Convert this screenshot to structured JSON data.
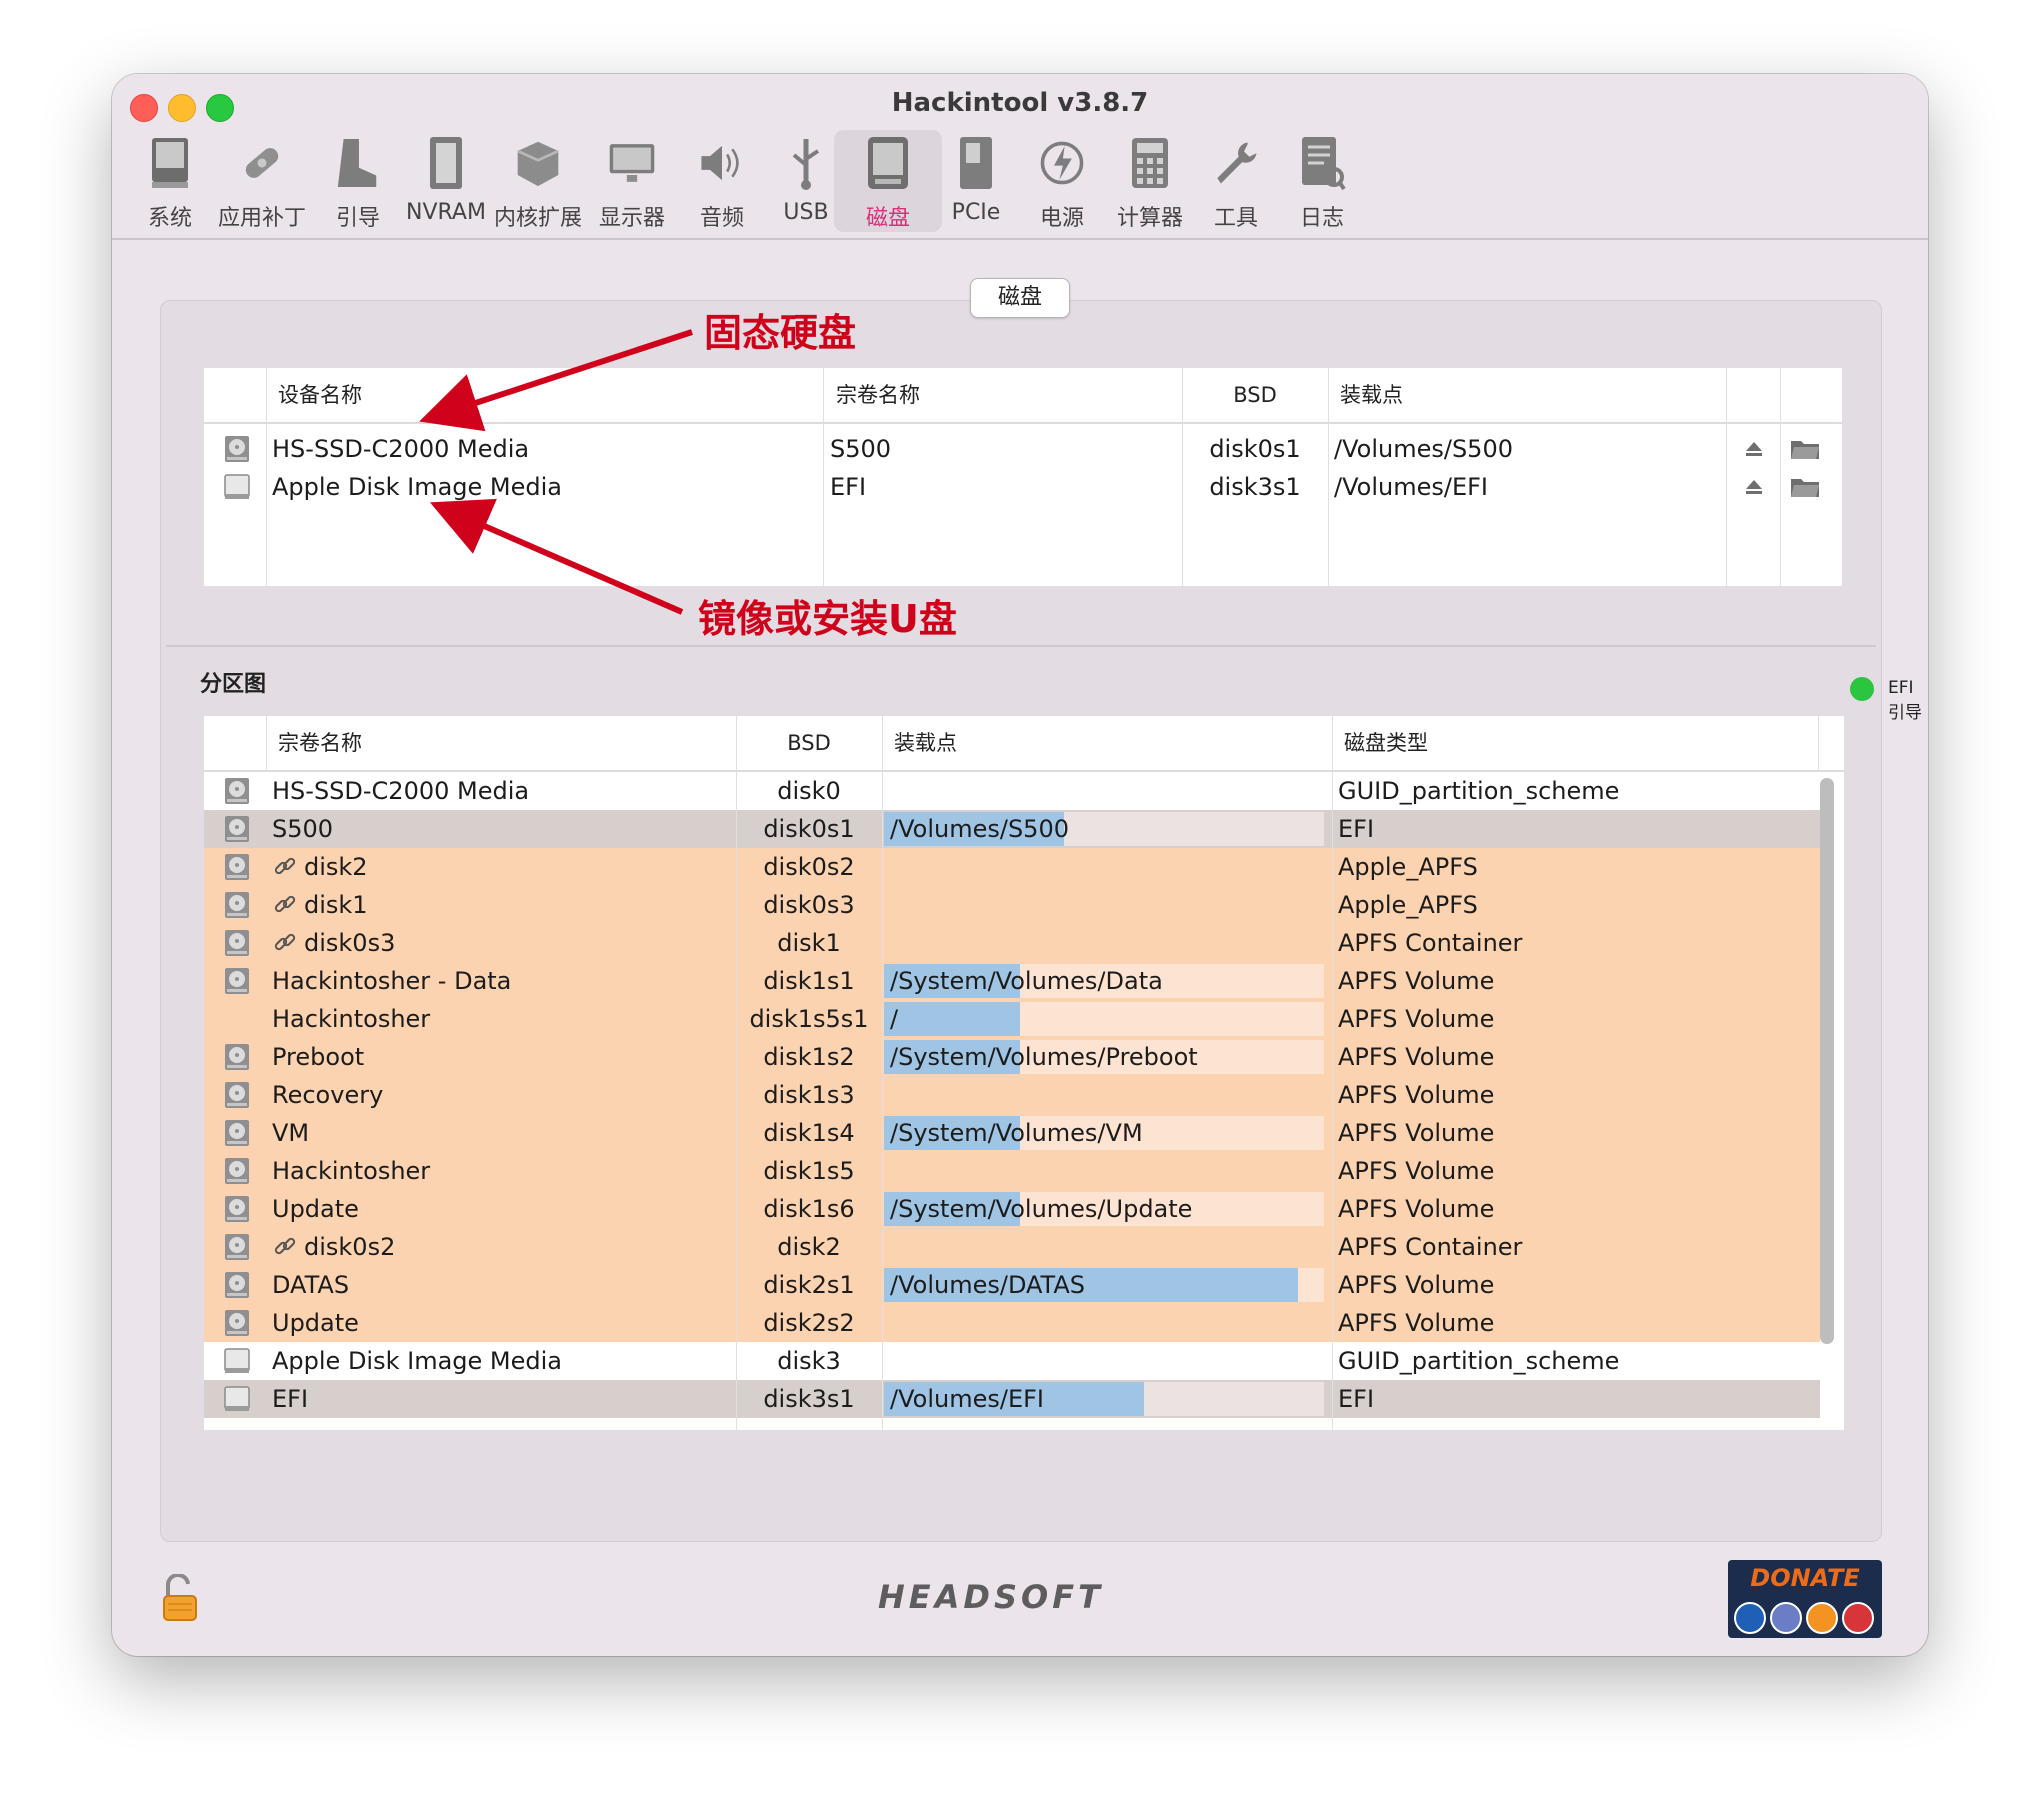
{
  "window": {
    "title": "Hackintool v3.8.7",
    "colors": {
      "close": "#ff5f57",
      "minimize": "#febc2e",
      "maximize": "#28c840",
      "accent": "#d6317a"
    }
  },
  "toolbar": {
    "items": [
      {
        "label": "系统",
        "icon": "computer-icon"
      },
      {
        "label": "应用补丁",
        "icon": "bandage-icon"
      },
      {
        "label": "引导",
        "icon": "boot-icon"
      },
      {
        "label": "NVRAM",
        "icon": "memory-chip-icon"
      },
      {
        "label": "内核扩展",
        "icon": "kext-box-icon"
      },
      {
        "label": "显示器",
        "icon": "monitor-icon"
      },
      {
        "label": "音频",
        "icon": "speaker-icon"
      },
      {
        "label": "USB",
        "icon": "usb-icon"
      },
      {
        "label": "磁盘",
        "icon": "disk-icon",
        "active": true
      },
      {
        "label": "PCIe",
        "icon": "pcie-card-icon"
      },
      {
        "label": "电源",
        "icon": "power-icon"
      },
      {
        "label": "计算器",
        "icon": "calculator-icon"
      },
      {
        "label": "工具",
        "icon": "wrench-icon"
      },
      {
        "label": "日志",
        "icon": "log-icon"
      }
    ]
  },
  "segment": {
    "label": "磁盘"
  },
  "annotations": {
    "ssd": "固态硬盘",
    "usb": "镜像或安装U盘"
  },
  "devices_table": {
    "headers": {
      "device": "设备名称",
      "volume": "宗卷名称",
      "bsd": "BSD",
      "mount": "装载点"
    },
    "rows": [
      {
        "device": "HS-SSD-C2000 Media",
        "volume": "S500",
        "bsd": "disk0s1",
        "mount": "/Volumes/S500",
        "icon": "internal-disk-icon"
      },
      {
        "device": "Apple Disk Image Media",
        "volume": "EFI",
        "bsd": "disk3s1",
        "mount": "/Volumes/EFI",
        "icon": "disk-image-icon"
      }
    ]
  },
  "efi_legend": {
    "label": "EFI 引导",
    "color": "#2ac640"
  },
  "partition_map": {
    "title": "分区图",
    "headers": {
      "volume": "宗卷名称",
      "bsd": "BSD",
      "mount": "装载点",
      "type": "磁盘类型"
    },
    "rows": [
      {
        "volume": "HS-SSD-C2000 Media",
        "bsd": "disk0",
        "mount": "",
        "type": "GUID_partition_scheme",
        "style": "white",
        "icon": "internal-disk-icon",
        "link": false,
        "fill": 0
      },
      {
        "volume": "S500",
        "bsd": "disk0s1",
        "mount": "/Volumes/S500",
        "type": "EFI",
        "style": "efi",
        "icon": "internal-disk-icon",
        "link": false,
        "fill": 0.41
      },
      {
        "volume": "disk2",
        "bsd": "disk0s2",
        "mount": "",
        "type": "Apple_APFS",
        "style": "orange",
        "icon": "internal-disk-icon",
        "link": true,
        "fill": 0
      },
      {
        "volume": "disk1",
        "bsd": "disk0s3",
        "mount": "",
        "type": "Apple_APFS",
        "style": "orange",
        "icon": "internal-disk-icon",
        "link": true,
        "fill": 0
      },
      {
        "volume": "disk0s3",
        "bsd": "disk1",
        "mount": "",
        "type": "APFS Container",
        "style": "orange",
        "icon": "internal-disk-icon",
        "link": true,
        "fill": 0
      },
      {
        "volume": "Hackintosher - Data",
        "bsd": "disk1s1",
        "mount": "/System/Volumes/Data",
        "type": "APFS Volume",
        "style": "orange",
        "icon": "internal-disk-icon",
        "link": false,
        "fill": 0.31
      },
      {
        "volume": "Hackintosher",
        "bsd": "disk1s5s1",
        "mount": "/",
        "type": "APFS Volume",
        "style": "orange",
        "icon": "",
        "link": false,
        "fill": 0.31
      },
      {
        "volume": "Preboot",
        "bsd": "disk1s2",
        "mount": "/System/Volumes/Preboot",
        "type": "APFS Volume",
        "style": "orange",
        "icon": "internal-disk-icon",
        "link": false,
        "fill": 0.31
      },
      {
        "volume": "Recovery",
        "bsd": "disk1s3",
        "mount": "",
        "type": "APFS Volume",
        "style": "orange",
        "icon": "internal-disk-icon",
        "link": false,
        "fill": 0
      },
      {
        "volume": "VM",
        "bsd": "disk1s4",
        "mount": "/System/Volumes/VM",
        "type": "APFS Volume",
        "style": "orange",
        "icon": "internal-disk-icon",
        "link": false,
        "fill": 0.31
      },
      {
        "volume": "Hackintosher",
        "bsd": "disk1s5",
        "mount": "",
        "type": "APFS Volume",
        "style": "orange",
        "icon": "internal-disk-icon",
        "link": false,
        "fill": 0
      },
      {
        "volume": "Update",
        "bsd": "disk1s6",
        "mount": "/System/Volumes/Update",
        "type": "APFS Volume",
        "style": "orange",
        "icon": "internal-disk-icon",
        "link": false,
        "fill": 0.31
      },
      {
        "volume": "disk0s2",
        "bsd": "disk2",
        "mount": "",
        "type": "APFS Container",
        "style": "orange",
        "icon": "internal-disk-icon",
        "link": true,
        "fill": 0
      },
      {
        "volume": "DATAS",
        "bsd": "disk2s1",
        "mount": "/Volumes/DATAS",
        "type": "APFS Volume",
        "style": "orange",
        "icon": "internal-disk-icon",
        "link": false,
        "fill": 0.94
      },
      {
        "volume": "Update",
        "bsd": "disk2s2",
        "mount": "",
        "type": "APFS Volume",
        "style": "orange",
        "icon": "internal-disk-icon",
        "link": false,
        "fill": 0
      },
      {
        "volume": "Apple Disk Image Media",
        "bsd": "disk3",
        "mount": "",
        "type": "GUID_partition_scheme",
        "style": "white",
        "icon": "disk-image-icon",
        "link": false,
        "fill": 0
      },
      {
        "volume": "EFI",
        "bsd": "disk3s1",
        "mount": "/Volumes/EFI",
        "type": "EFI",
        "style": "efi",
        "icon": "disk-image-icon",
        "link": false,
        "fill": 0.59
      }
    ]
  },
  "footer": {
    "brand": "HEADSOFT",
    "donate": "DONATE",
    "donate_coins": [
      "paypal-icon",
      "ethereum-icon",
      "bitcoin-icon",
      "litecoin-icon"
    ]
  }
}
